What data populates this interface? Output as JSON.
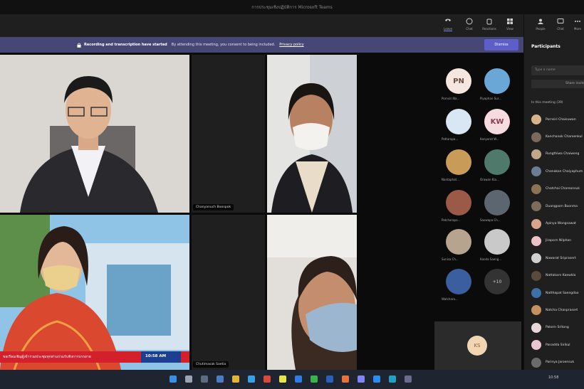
{
  "window": {
    "title": "การประชุมเชิงปฏิบัติการ Microsoft Teams"
  },
  "toolbar": {
    "items": [
      {
        "label": "Leave",
        "color": "#cfcfcf"
      },
      {
        "label": "Chat",
        "color": "#cfcfcf"
      },
      {
        "label": "Reactions",
        "color": "#cfcfcf"
      },
      {
        "label": "View",
        "color": "#cfcfcf"
      }
    ],
    "right_items": [
      {
        "label": "People"
      },
      {
        "label": "Chat"
      },
      {
        "label": "More"
      }
    ]
  },
  "banner": {
    "bold": "Recording and transcription have started",
    "message": "By attending this meeting, you consent to being included.",
    "link": "Privacy policy",
    "dismiss": "Dismiss"
  },
  "tiles": [
    {
      "name": ""
    },
    {
      "name": "Chanyanuch Boonpok"
    },
    {
      "name": ""
    },
    {
      "name": ""
    },
    {
      "name": "Chutimasak Saetia"
    },
    {
      "name": ""
    }
  ],
  "broadcast": {
    "ticker": "ขอเรียนเชิญผู้เข้าร่วมประชุมทุกท่านร่วมรับฟังการบรรยาย",
    "time": "10:58 AM"
  },
  "gallery": [
    {
      "initials": "PN",
      "name": "Pornsiri Na...",
      "bg": "#f5e6df",
      "fg": "#6b4d3e"
    },
    {
      "initials": "",
      "name": "Piyaphan Sur...",
      "bg": "#6aa6d6",
      "fg": "#fff"
    },
    {
      "initials": "",
      "name": "Pattarapa...",
      "bg": "#d9e7f5",
      "fg": "#fff"
    },
    {
      "initials": "KW",
      "name": "Kanyarat W...",
      "bg": "#f6dbe0",
      "fg": "#8a3d4e"
    },
    {
      "initials": "",
      "name": "Nantaphat...",
      "bg": "#c99b58",
      "fg": "#fff"
    },
    {
      "initials": "",
      "name": "Orawan Kla...",
      "bg": "#4f7a6b",
      "fg": "#fff"
    },
    {
      "initials": "",
      "name": "Patcharapo...",
      "bg": "#9b5a48",
      "fg": "#fff"
    },
    {
      "initials": "",
      "name": "Saowapa Ch...",
      "bg": "#5c6670",
      "fg": "#fff"
    },
    {
      "initials": "",
      "name": "Sunisa Ch...",
      "bg": "#b7a48e",
      "fg": "#fff"
    },
    {
      "initials": "",
      "name": "Kanda Saeng...",
      "bg": "#c9c9c9",
      "fg": "#fff"
    },
    {
      "initials": "",
      "name": "Watchara...",
      "bg": "#3b5f9e",
      "fg": "#fff"
    }
  ],
  "gallery_more": "+10",
  "self_initials": "KS",
  "panel": {
    "title": "Participants",
    "invite_placeholder": "Type a name",
    "share_label": "Share invite",
    "section": "In this meeting (39)",
    "people": [
      {
        "name": "Pornsiri Chaisuwan",
        "color": "#d9b38c"
      },
      {
        "name": "Kanchanok Charoenkul",
        "color": "#7a6a5b"
      },
      {
        "name": "Rungthiwa Chaiwong",
        "color": "#c0a78a"
      },
      {
        "name": "Chanakan Chaiyaphum",
        "color": "#6a7d92"
      },
      {
        "name": "Chatchai Chareonsuk",
        "color": "#8b7355"
      },
      {
        "name": "Duangporn Boonma",
        "color": "#7e6b59"
      },
      {
        "name": "Apinya Wongsawat",
        "color": "#d9a38c"
      },
      {
        "name": "Jiraporn Nilphan",
        "color": "#f0c0c8"
      },
      {
        "name": "Nawarat Sriprasert",
        "color": "#cfd0d2"
      },
      {
        "name": "Nattakarn Kaewkla",
        "color": "#5a4a3e"
      },
      {
        "name": "Natthapat Saengdao",
        "color": "#3d6fa8"
      },
      {
        "name": "Natcha Chanprasert",
        "color": "#c4925f"
      },
      {
        "name": "Pakorn Sritong",
        "color": "#e8d7d9"
      },
      {
        "name": "Panadda Sirikul",
        "color": "#e9c7d1"
      },
      {
        "name": "Parinya Jaroensuk",
        "color": "#6b6b6b"
      }
    ]
  },
  "taskbar": {
    "clock": "10:58"
  }
}
